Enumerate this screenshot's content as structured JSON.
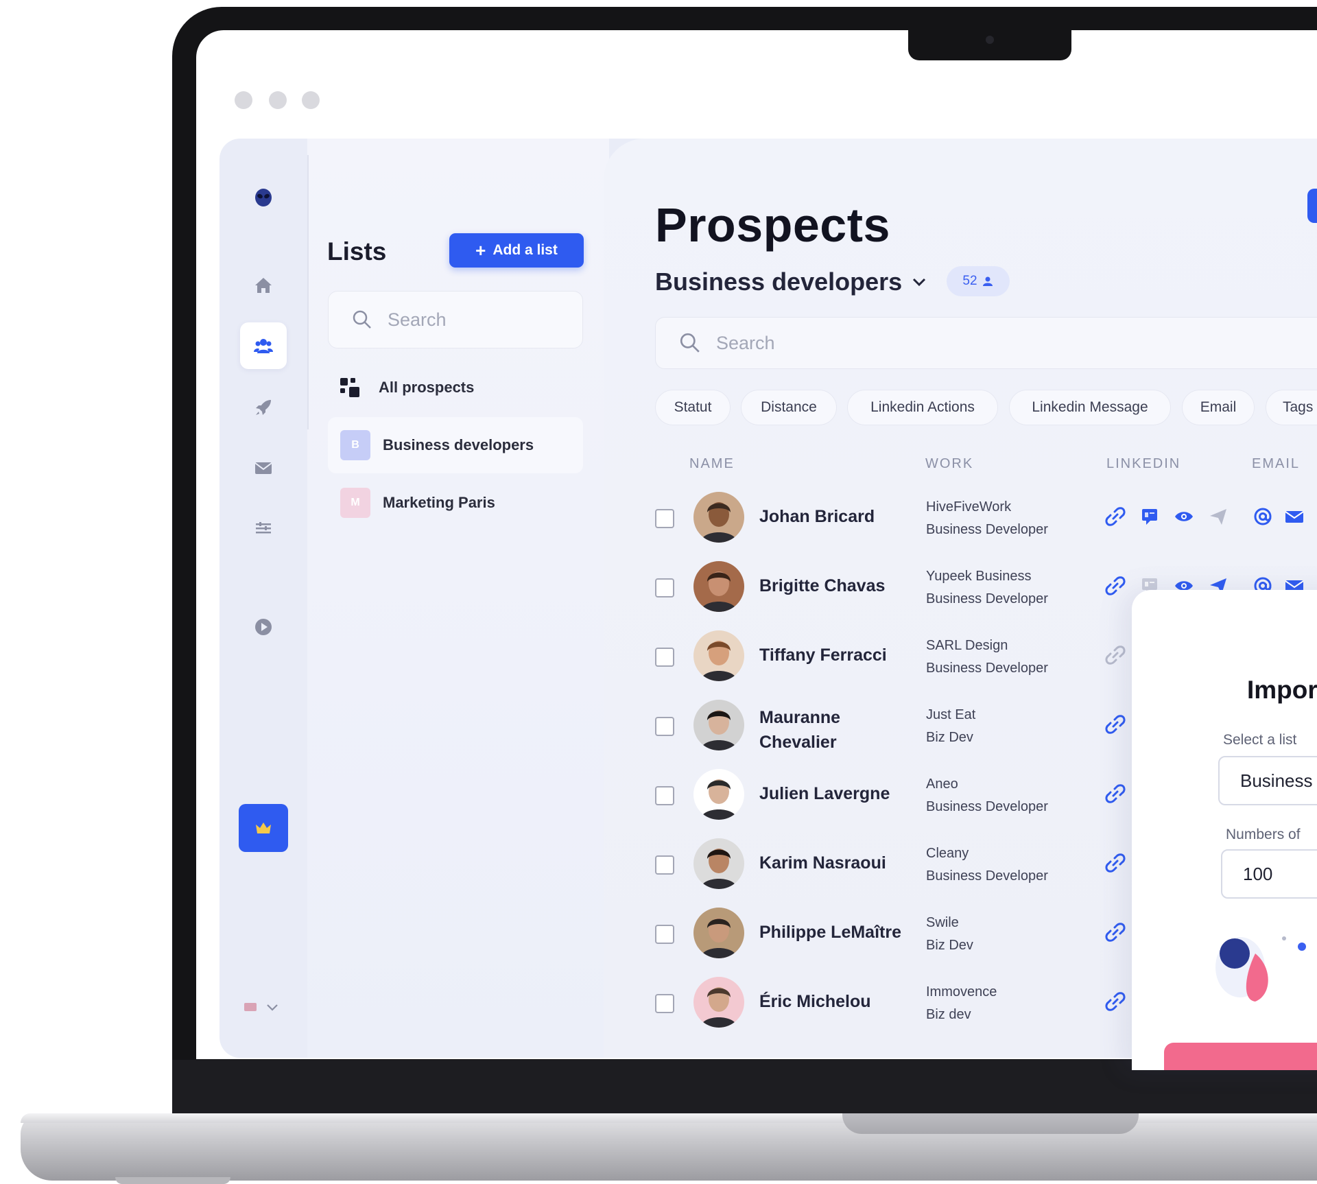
{
  "sidebar": {
    "icons": [
      "alien-logo-icon",
      "home-icon",
      "users-icon",
      "rocket-icon",
      "mail-icon",
      "filters-icon",
      "play-icon",
      "crown-icon"
    ],
    "language_flag": "uk-flag-icon"
  },
  "lists": {
    "title": "Lists",
    "add_label": "Add a list",
    "search_placeholder": "Search",
    "items": [
      {
        "label": "All prospects"
      },
      {
        "label": "Business developers",
        "initial": "B",
        "color": "#c6cdf7"
      },
      {
        "label": "Marketing Paris",
        "initial": "M",
        "color": "#f2d3e1"
      }
    ]
  },
  "main": {
    "title": "Prospects",
    "list_name": "Business developers",
    "count": "52",
    "search_placeholder": "Search",
    "filters": [
      "Statut",
      "Distance",
      "Linkedin Actions",
      "Linkedin Message",
      "Email",
      "Tags"
    ],
    "columns": [
      "NAME",
      "WORK",
      "LINKEDIN",
      "EMAIL"
    ]
  },
  "prospects": [
    {
      "name": "Johan Bricard",
      "company": "HiveFiveWork",
      "role": "Business Developer",
      "skin": "#8a5a3b",
      "hair": "#3b2a20",
      "bg": "#caa88a"
    },
    {
      "name": "Brigitte Chavas",
      "company": "Yupeek Business",
      "role": "Business Developer",
      "skin": "#c89072",
      "hair": "#3a2418",
      "bg": "#a46a4a"
    },
    {
      "name": "Tiffany Ferracci",
      "company": "SARL Design",
      "role": "Business Developer",
      "skin": "#d6a07c",
      "hair": "#7a4a2a",
      "bg": "#e9d6c4"
    },
    {
      "name": "Mauranne Chevalier",
      "company": "Just Eat",
      "role": "Biz Dev",
      "skin": "#d7b39c",
      "hair": "#1b1614",
      "bg": "#d2d2d2"
    },
    {
      "name": "Julien Lavergne",
      "company": "Aneo",
      "role": "Business Developer",
      "skin": "#d8b39a",
      "hair": "#2a2a2a",
      "bg": "#ffffff"
    },
    {
      "name": "Karim Nasraoui",
      "company": "Cleany",
      "role": "Business Developer",
      "skin": "#b98564",
      "hair": "#1e1613",
      "bg": "#dcdcdc"
    },
    {
      "name": "Philippe LeMaître",
      "company": "Swile",
      "role": "Biz Dev",
      "skin": "#c99a7c",
      "hair": "#2a2320",
      "bg": "#b89a78"
    },
    {
      "name": "Éric Michelou",
      "company": "Immovence",
      "role": "Biz dev",
      "skin": "#d3a88c",
      "hair": "#4b3a2e",
      "bg": "#f3c9d1"
    }
  ],
  "modal": {
    "title": "Impor",
    "select_label": "Select a list",
    "select_value": "Business",
    "number_label": "Numbers of",
    "number_value": "100"
  },
  "colors": {
    "accent": "#2f5bf0",
    "link_active": "#2f5bf0",
    "link_inactive": "#b6bacb",
    "cta_pink": "#f26a8d"
  }
}
